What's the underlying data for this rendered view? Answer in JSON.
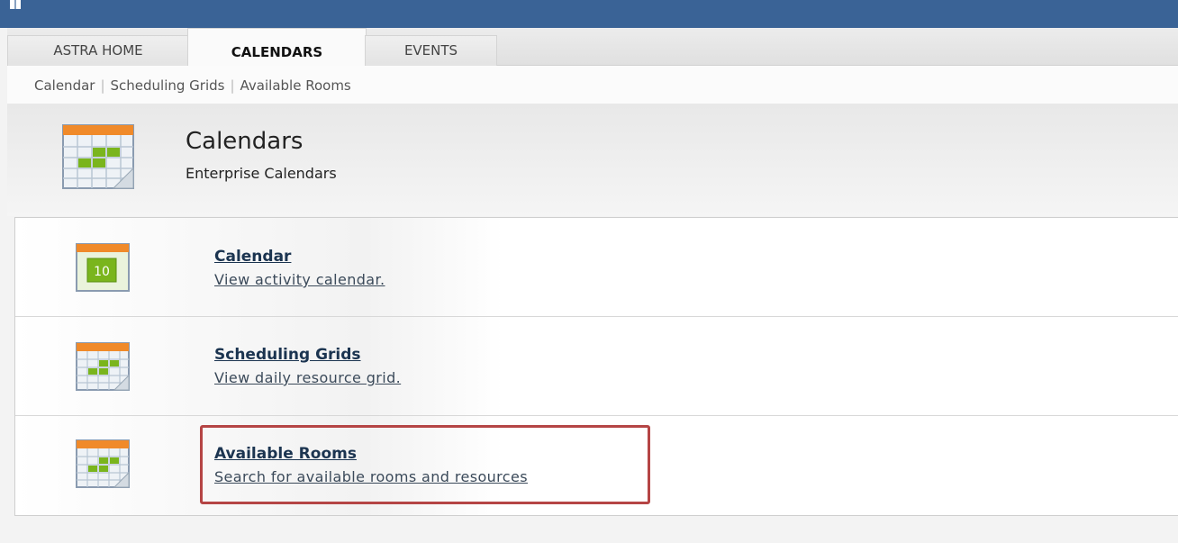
{
  "tabs": [
    {
      "label": "ASTRA HOME",
      "active": false
    },
    {
      "label": "CALENDARS",
      "active": true
    },
    {
      "label": "EVENTS",
      "active": false
    }
  ],
  "subnav": {
    "items": [
      "Calendar",
      "Scheduling Grids",
      "Available Rooms"
    ],
    "separator": "|"
  },
  "header": {
    "title": "Calendars",
    "subtitle": "Enterprise Calendars",
    "icon": "calendar-grid-icon"
  },
  "menu": [
    {
      "label": "Calendar",
      "description": "View activity calendar.",
      "icon": "calendar-day-icon",
      "icon_text": "10"
    },
    {
      "label": "Scheduling Grids",
      "description": "View daily resource grid.",
      "icon": "calendar-grid-icon"
    },
    {
      "label": "Available Rooms",
      "description": "Search for available rooms and resources",
      "icon": "calendar-grid-icon",
      "highlighted": true
    }
  ],
  "colors": {
    "topbar": "#3a6396",
    "link": "#1b3450",
    "highlight": "#b54545",
    "icon_orange": "#f08a2a",
    "icon_green": "#7ab51d"
  }
}
